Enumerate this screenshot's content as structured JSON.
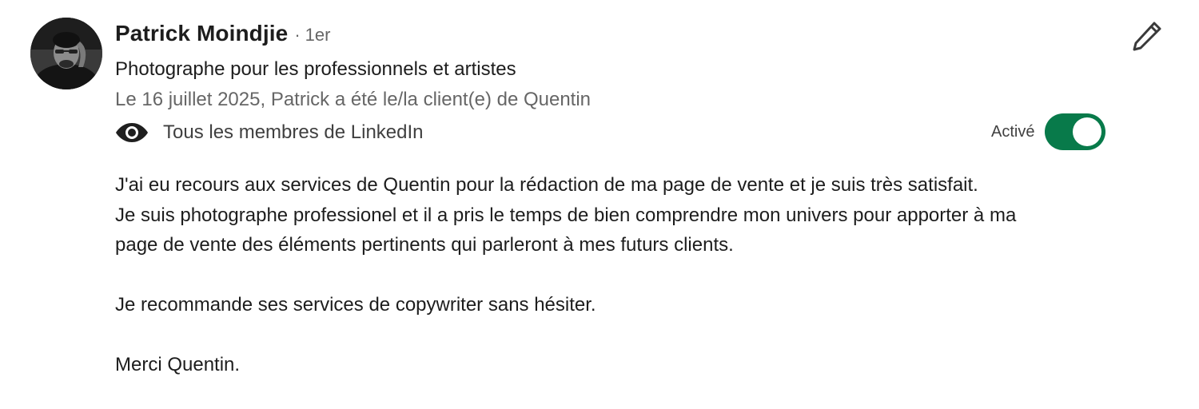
{
  "recommendation": {
    "author": {
      "name": "Patrick Moindjie",
      "separator": "·",
      "degree": "1er",
      "headline": "Photographe pour les professionnels et artistes",
      "relation": "Le 16 juillet 2025, Patrick a été le/la client(e) de Quentin",
      "avatar_icon": "profile-photo"
    },
    "visibility": {
      "icon": "eye-icon",
      "label": "Tous les membres de LinkedIn"
    },
    "toggle": {
      "label": "Activé",
      "state": "on",
      "color": "#087a4a"
    },
    "edit_icon": "pencil-icon",
    "text": {
      "line1": "J'ai eu recours aux services de Quentin pour la rédaction de ma page de vente et je suis très satisfait.",
      "line2": "Je suis photographe professionel et il a pris le temps de bien comprendre mon univers pour apporter à ma",
      "line3": "page de vente des éléments pertinents qui parleront à mes futurs clients.",
      "line4": "Je recommande ses services de copywriter sans hésiter.",
      "line5": "Merci Quentin."
    }
  }
}
